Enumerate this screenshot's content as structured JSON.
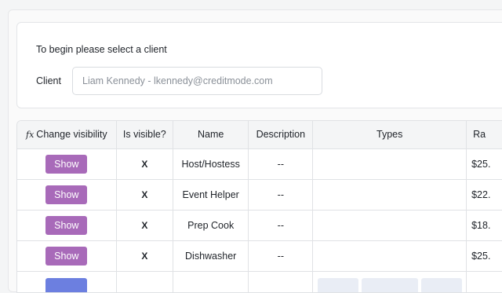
{
  "client_section": {
    "intro": "To begin please select a client",
    "client_label": "Client",
    "client_placeholder": "Liam Kennedy - lkennedy@creditmode.com"
  },
  "table": {
    "headers": {
      "change_visibility": "Change visibility",
      "change_visibility_icon": "fx-icon",
      "is_visible": "Is visible?",
      "name": "Name",
      "description": "Description",
      "types": "Types",
      "rate": "Ra"
    },
    "rows": [
      {
        "button": "Show",
        "visible": "X",
        "name": "Host/Hostess",
        "description": "--",
        "rate": "$25."
      },
      {
        "button": "Show",
        "visible": "X",
        "name": "Event Helper",
        "description": "--",
        "rate": "$22."
      },
      {
        "button": "Show",
        "visible": "X",
        "name": "Prep Cook",
        "description": "--",
        "rate": "$18."
      },
      {
        "button": "Show",
        "visible": "X",
        "name": "Dishwasher",
        "description": "--",
        "rate": "$25."
      }
    ]
  },
  "colors": {
    "show_button": "#a86ab9",
    "partial_button": "#6c7fe0"
  }
}
